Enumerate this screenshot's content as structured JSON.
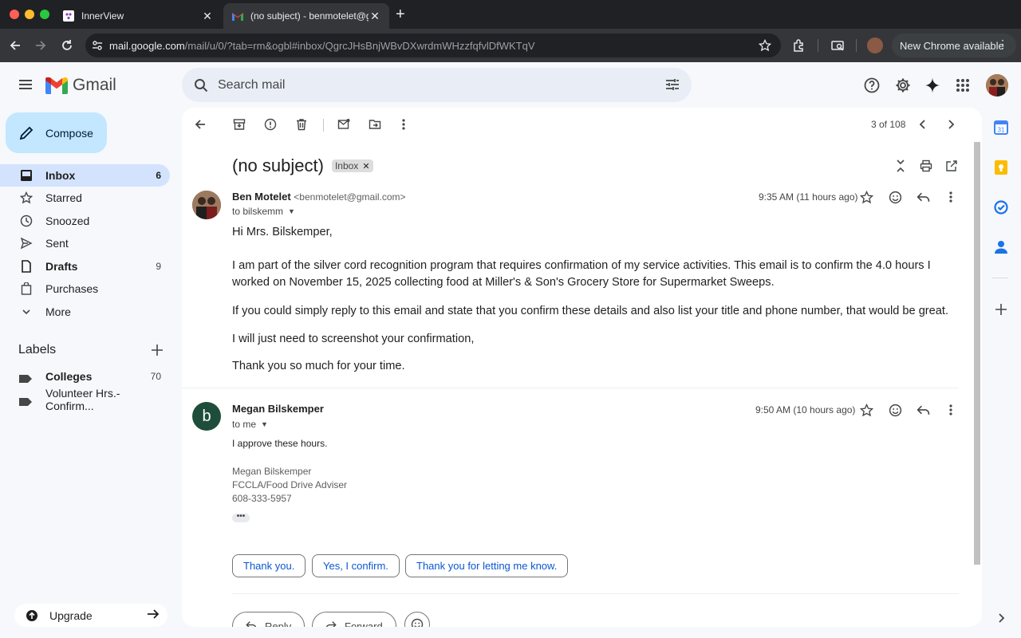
{
  "browser": {
    "tabs": [
      {
        "title": "InnerView",
        "favicon": "innerview-icon"
      },
      {
        "title": "(no subject) - benmotelet@gmail.com",
        "favicon": "gmail-icon",
        "active": true
      }
    ],
    "url_host": "mail.google.com",
    "url_path": "/mail/u/0/?tab=rm&ogbl#inbox/QgrcJHsBnjWBvDXwrdmWHzzfqfvlDfWKTqV",
    "update_label": "New Chrome available"
  },
  "gmail": {
    "brand": "Gmail",
    "search_placeholder": "Search mail"
  },
  "sidebar": {
    "compose_label": "Compose",
    "items": [
      {
        "label": "Inbox",
        "count": "6",
        "icon": "inbox-icon",
        "active": true
      },
      {
        "label": "Starred",
        "count": "",
        "icon": "star-icon"
      },
      {
        "label": "Snoozed",
        "count": "",
        "icon": "clock-icon"
      },
      {
        "label": "Sent",
        "count": "",
        "icon": "send-icon"
      },
      {
        "label": "Drafts",
        "count": "9",
        "icon": "draft-icon"
      },
      {
        "label": "Purchases",
        "count": "",
        "icon": "shopping-bag-icon"
      },
      {
        "label": "More",
        "count": "",
        "icon": "chevron-down-icon"
      }
    ],
    "labels_header": "Labels",
    "labels": [
      {
        "label": "Colleges",
        "count": "70"
      },
      {
        "label": "Volunteer Hrs.- Confirm...",
        "count": ""
      }
    ],
    "upgrade_label": "Upgrade"
  },
  "thread": {
    "pager": "3 of 108",
    "subject": "(no subject)",
    "chip": "Inbox",
    "message1": {
      "sender_name": "Ben Motelet",
      "sender_email": "<benmotelet@gmail.com>",
      "to": "to bilskemm",
      "time": "9:35 AM (11 hours ago)",
      "paragraphs": [
        "Hi Mrs. Bilskemper,",
        "I am part of the silver cord recognition program that requires confirmation of my service activities. This email is to confirm the 4.0 hours I worked on November 15, 2025 collecting food at Miller's & Son's Grocery Store for Supermarket Sweeps.",
        "If you could simply reply to this email and state that you confirm these details and also list your title and phone number, that would be great.",
        "I will just need to screenshot your confirmation,",
        "Thank you so much for your time."
      ]
    },
    "message2": {
      "avatar_letter": "b",
      "sender_name": "Megan Bilskemper",
      "to": "to me",
      "time": "9:50 AM (10 hours ago)",
      "body": "I approve these hours.",
      "signature": [
        "Megan Bilskemper",
        "FCCLA/Food Drive Adviser",
        "608-333-5957"
      ],
      "ellipsis": "•••"
    },
    "smart_replies": [
      "Thank you.",
      "Yes, I confirm.",
      "Thank you for letting me know."
    ],
    "reply_label": "Reply",
    "forward_label": "Forward"
  },
  "colors": {
    "compose_bg": "#c2e7ff",
    "active_nav": "#d3e3fd",
    "link_blue": "#0b57d0"
  }
}
